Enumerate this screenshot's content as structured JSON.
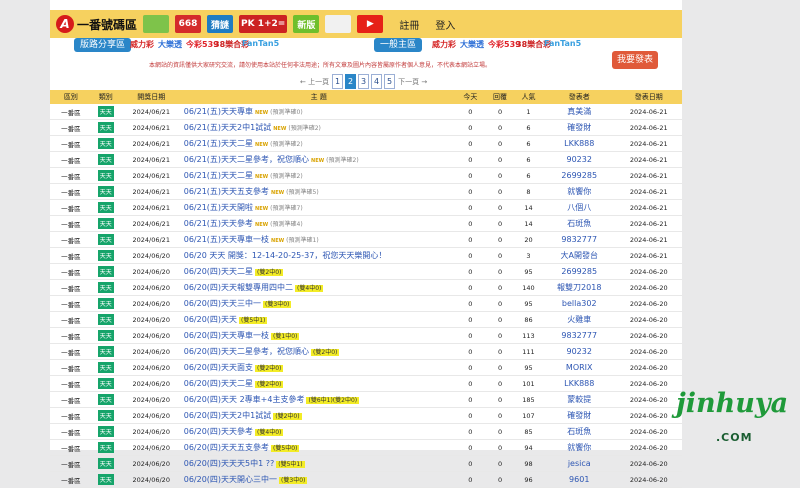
{
  "header": {
    "logo_text": "一番號碼區",
    "icons": [
      {
        "name": "chart-image-icon",
        "label": "",
        "color": "#7ec34a"
      },
      {
        "name": "668-icon",
        "label": "668",
        "color": "#d42b2b"
      },
      {
        "name": "lottery-draw-icon",
        "label": "猜謎",
        "color": "#1f7cc2"
      },
      {
        "name": "pk-icon",
        "label": "PK 1+2=",
        "color": "#c22"
      },
      {
        "name": "new-version-icon",
        "label": "新版",
        "color": "#6fbf2c"
      },
      {
        "name": "person-icon",
        "label": "",
        "color": "#f1f1f1"
      },
      {
        "name": "youtube-icon",
        "label": "▶",
        "color": "#e62117"
      }
    ],
    "register": "註冊",
    "login": "登入"
  },
  "subbar": {
    "left_pill": "版路分享區",
    "right_pill": "一般主區",
    "brands_left": [
      "威力彩",
      "大樂透",
      "今彩539",
      "38樂合彩",
      "FanTan5"
    ],
    "brands_right": [
      "威力彩",
      "大樂透",
      "今彩539",
      "38樂合彩",
      "FanTan5"
    ]
  },
  "notice": "本網站的資訊僅供大家研究交流，請勿使用本站於任何非法用途；所有文章及圖片內容皆屬原作者個人意見，不代表本網站立場。",
  "post_button": "我要發表",
  "pager": {
    "prev": "← 上一頁",
    "pages": [
      "1",
      "2",
      "3",
      "4",
      "5"
    ],
    "active_index": 1,
    "next": "下一頁 →"
  },
  "columns": [
    "區別",
    "類別",
    "開獎日期",
    "主 題",
    "今天",
    "回覆",
    "人氣",
    "發表者",
    "發表日期"
  ],
  "rows": [
    {
      "area": "一番區",
      "kind": "天天",
      "date": "2024/06/21",
      "title": "06/21(五)天天專車",
      "new": "NEW",
      "note": "(預測準確0)",
      "hl": "",
      "today": "0",
      "reply": "0",
      "views": "1",
      "poster": "真美滿",
      "pdate": "2024-06-21"
    },
    {
      "area": "一番區",
      "kind": "天天",
      "date": "2024/06/21",
      "title": "06/21(五)天天2中1試試",
      "new": "NEW",
      "note": "(預測準確2)",
      "hl": "",
      "today": "0",
      "reply": "0",
      "views": "6",
      "poster": "確發財",
      "pdate": "2024-06-21"
    },
    {
      "area": "一番區",
      "kind": "天天",
      "date": "2024/06/21",
      "title": "06/21(五)天天二星",
      "new": "NEW",
      "note": "(預測準確2)",
      "hl": "",
      "today": "0",
      "reply": "0",
      "views": "6",
      "poster": "LKK888",
      "pdate": "2024-06-21"
    },
    {
      "area": "一番區",
      "kind": "天天",
      "date": "2024/06/21",
      "title": "06/21(五)天天二星參考，祝您順心",
      "new": "NEW",
      "note": "(預測準確2)",
      "hl": "",
      "today": "0",
      "reply": "0",
      "views": "6",
      "poster": "90232",
      "pdate": "2024-06-21"
    },
    {
      "area": "一番區",
      "kind": "天天",
      "date": "2024/06/21",
      "title": "06/21(五)天天二星",
      "new": "NEW",
      "note": "(預測準確2)",
      "hl": "",
      "today": "0",
      "reply": "0",
      "views": "6",
      "poster": "2699285",
      "pdate": "2024-06-21"
    },
    {
      "area": "一番區",
      "kind": "天天",
      "date": "2024/06/21",
      "title": "06/21(五)天天五支參考",
      "new": "NEW",
      "note": "(預測準確5)",
      "hl": "",
      "today": "0",
      "reply": "0",
      "views": "8",
      "poster": "就饗你",
      "pdate": "2024-06-21"
    },
    {
      "area": "一番區",
      "kind": "天天",
      "date": "2024/06/21",
      "title": "06/21(五)天天開啦",
      "new": "NEW",
      "note": "(預測準確7)",
      "hl": "",
      "today": "0",
      "reply": "0",
      "views": "14",
      "poster": "八個八",
      "pdate": "2024-06-21"
    },
    {
      "area": "一番區",
      "kind": "天天",
      "date": "2024/06/21",
      "title": "06/21(五)天天參考",
      "new": "NEW",
      "note": "(預測準確4)",
      "hl": "",
      "today": "0",
      "reply": "0",
      "views": "14",
      "poster": "石斑魚",
      "pdate": "2024-06-21"
    },
    {
      "area": "一番區",
      "kind": "天天",
      "date": "2024/06/21",
      "title": "06/21(五)天天專車一枝",
      "new": "NEW",
      "note": "(預測準確1)",
      "hl": "",
      "today": "0",
      "reply": "0",
      "views": "20",
      "poster": "9832777",
      "pdate": "2024-06-21"
    },
    {
      "area": "一番區",
      "kind": "天天",
      "date": "2024/06/20",
      "title": "06/20 天天 開獎：12-14-20-25-37，祝您天天樂開心！",
      "new": "",
      "note": "",
      "hl": "",
      "today": "0",
      "reply": "0",
      "views": "3",
      "poster": "大A開發台",
      "pdate": "2024-06-21"
    },
    {
      "area": "一番區",
      "kind": "天天",
      "date": "2024/06/20",
      "title": "06/20(四)天天二星",
      "new": "",
      "note": "",
      "hl": "(雙2中0)",
      "today": "0",
      "reply": "0",
      "views": "95",
      "poster": "2699285",
      "pdate": "2024-06-20"
    },
    {
      "area": "一番區",
      "kind": "天天",
      "date": "2024/06/20",
      "title": "06/20(四)天天報雙專用四中二",
      "new": "",
      "note": "",
      "hl": "(雙4中0)",
      "today": "0",
      "reply": "0",
      "views": "140",
      "poster": "報雙刀2018",
      "pdate": "2024-06-20"
    },
    {
      "area": "一番區",
      "kind": "天天",
      "date": "2024/06/20",
      "title": "06/20(四)天天三中一",
      "new": "",
      "note": "",
      "hl": "(雙3中0)",
      "today": "0",
      "reply": "0",
      "views": "95",
      "poster": "bella302",
      "pdate": "2024-06-20"
    },
    {
      "area": "一番區",
      "kind": "天天",
      "date": "2024/06/20",
      "title": "06/20(四)天天",
      "new": "",
      "note": "",
      "hl": "(雙5中1)",
      "today": "0",
      "reply": "0",
      "views": "86",
      "poster": "火雞車",
      "pdate": "2024-06-20"
    },
    {
      "area": "一番區",
      "kind": "天天",
      "date": "2024/06/20",
      "title": "06/20(四)天天專車一枝",
      "new": "",
      "note": "",
      "hl": "(雙1中0)",
      "today": "0",
      "reply": "0",
      "views": "113",
      "poster": "9832777",
      "pdate": "2024-06-20"
    },
    {
      "area": "一番區",
      "kind": "天天",
      "date": "2024/06/20",
      "title": "06/20(四)天天二星參考，祝您順心",
      "new": "",
      "note": "",
      "hl": "(雙2中0)",
      "today": "0",
      "reply": "0",
      "views": "111",
      "poster": "90232",
      "pdate": "2024-06-20"
    },
    {
      "area": "一番區",
      "kind": "天天",
      "date": "2024/06/20",
      "title": "06/20(四)天天面支",
      "new": "",
      "note": "",
      "hl": "(雙2中0)",
      "today": "0",
      "reply": "0",
      "views": "95",
      "poster": "MORIX",
      "pdate": "2024-06-20"
    },
    {
      "area": "一番區",
      "kind": "天天",
      "date": "2024/06/20",
      "title": "06/20(四)天天二星",
      "new": "",
      "note": "",
      "hl": "(雙2中0)",
      "today": "0",
      "reply": "0",
      "views": "101",
      "poster": "LKK888",
      "pdate": "2024-06-20"
    },
    {
      "area": "一番區",
      "kind": "天天",
      "date": "2024/06/20",
      "title": "06/20(四)天天 2專車+4主支參考",
      "new": "",
      "note": "",
      "hl": "(雙6中1)(雙2中0)",
      "today": "0",
      "reply": "0",
      "views": "185",
      "poster": "蒙較提",
      "pdate": "2024-06-20"
    },
    {
      "area": "一番區",
      "kind": "天天",
      "date": "2024/06/20",
      "title": "06/20(四)天天2中1試試",
      "new": "",
      "note": "",
      "hl": "(雙2中0)",
      "today": "0",
      "reply": "0",
      "views": "107",
      "poster": "確發財",
      "pdate": "2024-06-20"
    },
    {
      "area": "一番區",
      "kind": "天天",
      "date": "2024/06/20",
      "title": "06/20(四)天天參考",
      "new": "",
      "note": "",
      "hl": "(雙4中0)",
      "today": "0",
      "reply": "0",
      "views": "85",
      "poster": "石斑魚",
      "pdate": "2024-06-20"
    },
    {
      "area": "一番區",
      "kind": "天天",
      "date": "2024/06/20",
      "title": "06/20(四)天天五支參考",
      "new": "",
      "note": "",
      "hl": "(雙5中0)",
      "today": "0",
      "reply": "0",
      "views": "94",
      "poster": "就饗你",
      "pdate": "2024-06-20"
    },
    {
      "area": "一番區",
      "kind": "天天",
      "date": "2024/06/20",
      "title": "06/20(四)天天天5中1 ??",
      "new": "",
      "note": "",
      "hl": "(雙5中1)",
      "today": "0",
      "reply": "0",
      "views": "98",
      "poster": "jesica",
      "pdate": "2024-06-20"
    },
    {
      "area": "一番區",
      "kind": "天天",
      "date": "2024/06/20",
      "title": "06/20(四)天天開心三中一",
      "new": "",
      "note": "",
      "hl": "(雙3中0)",
      "today": "0",
      "reply": "0",
      "views": "96",
      "poster": "9601",
      "pdate": "2024-06-20"
    }
  ],
  "watermark": {
    "text": "jinhuya",
    "sub": ".COM"
  },
  "colors": {
    "topbar": "#f6d15f",
    "accent": "#2a86c8",
    "badge": "#16a46a",
    "highlight": "#f3ec26"
  }
}
